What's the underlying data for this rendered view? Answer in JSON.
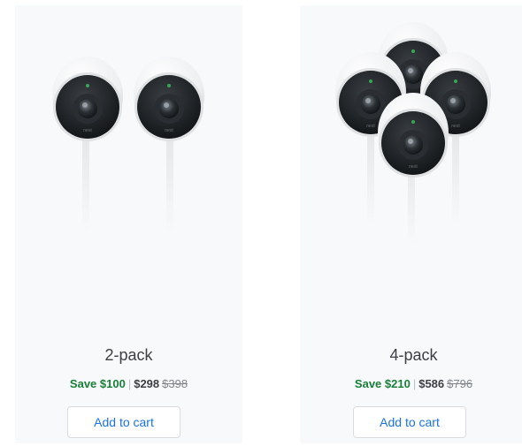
{
  "products": [
    {
      "title": "2-pack",
      "save_text": "Save $100",
      "separator": "|",
      "price": "$298",
      "original_price": "$398",
      "button_label": "Add to cart",
      "camera_brand": "nest"
    },
    {
      "title": "4-pack",
      "save_text": "Save $210",
      "separator": "|",
      "price": "$586",
      "original_price": "$796",
      "button_label": "Add to cart",
      "camera_brand": "nest"
    }
  ],
  "colors": {
    "card_background": "#f8f9fa",
    "save_green": "#188038",
    "button_blue": "#1a73e8",
    "camera_body": "#ffffff",
    "camera_lens": "#1f2326",
    "status_led": "#34a853"
  },
  "icons": {
    "product_image_2pack": "two-nest-cam-outdoor-image",
    "product_image_4pack": "four-nest-cam-outdoor-image"
  }
}
